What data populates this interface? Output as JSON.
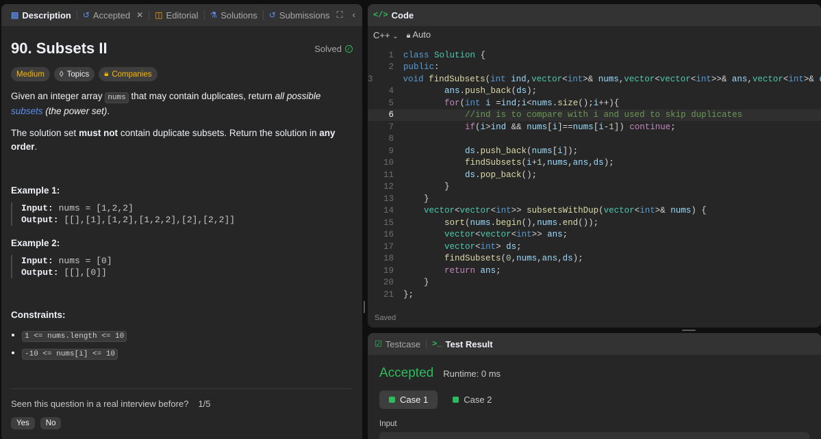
{
  "left_tabs": [
    {
      "label": "Description",
      "icon": "document-icon"
    },
    {
      "label": "Accepted",
      "icon": "history-icon"
    },
    {
      "label": "Editorial",
      "icon": "book-icon"
    },
    {
      "label": "Solutions",
      "icon": "flask-icon"
    },
    {
      "label": "Submissions",
      "icon": "history-icon"
    }
  ],
  "problem": {
    "title": "90. Subsets II",
    "status": "Solved",
    "difficulty": "Medium",
    "topics_label": "Topics",
    "companies_label": "Companies",
    "desc1_a": "Given an integer array ",
    "desc1_code": "nums",
    "desc1_b": " that may contain duplicates, return ",
    "desc1_c": "all possible ",
    "desc1_link": "subsets",
    "desc1_d": " (the power set)",
    "desc1_e": ".",
    "desc2_a": "The solution set ",
    "desc2_b": "must not",
    "desc2_c": " contain duplicate subsets. Return the solution in ",
    "desc2_d": "any order",
    "desc2_e": ".",
    "examples": [
      {
        "title": "Example 1:",
        "input_label": "Input:",
        "input": " nums = [1,2,2]",
        "output_label": "Output:",
        "output": " [[],[1],[1,2],[1,2,2],[2],[2,2]]"
      },
      {
        "title": "Example 2:",
        "input_label": "Input:",
        "input": " nums = [0]",
        "output_label": "Output:",
        "output": " [[],[0]]"
      }
    ],
    "constraints_title": "Constraints:",
    "constraints": [
      "1 <= nums.length <= 10",
      "-10 <= nums[i] <= 10"
    ],
    "interview_q": "Seen this question in a real interview before?",
    "interview_count": "1/5",
    "yes": "Yes",
    "no": "No"
  },
  "code_panel": {
    "title": "Code",
    "language": "C++",
    "mode": "Auto",
    "status": "Saved",
    "current_line": 6,
    "lines": [
      "class Solution {",
      "public:",
      "    void findSubsets(int ind,vector<int>& nums,vector<vector<int>>& ans,vector<int>& ds){",
      "        ans.push_back(ds);",
      "        for(int i =ind;i<nums.size();i++){",
      "            //ind is to compare with i and used to skip duplicates",
      "            if(i>ind && nums[i]==nums[i-1]) continue;",
      "",
      "            ds.push_back(nums[i]);",
      "            findSubsets(i+1,nums,ans,ds);",
      "            ds.pop_back();",
      "        }",
      "    }",
      "    vector<vector<int>> subsetsWithDup(vector<int>& nums) {",
      "        sort(nums.begin(),nums.end());",
      "        vector<vector<int>> ans;",
      "        vector<int> ds;",
      "        findSubsets(0,nums,ans,ds);",
      "        return ans;",
      "    }",
      "};"
    ]
  },
  "result_panel": {
    "tabs": [
      "Testcase",
      "Test Result"
    ],
    "verdict": "Accepted",
    "runtime": "Runtime: 0 ms",
    "cases": [
      "Case 1",
      "Case 2"
    ],
    "input_label": "Input"
  },
  "colors": {
    "accent_green": "#2cbb5d",
    "medium": "#ffb800",
    "link_blue": "#5b8def"
  }
}
